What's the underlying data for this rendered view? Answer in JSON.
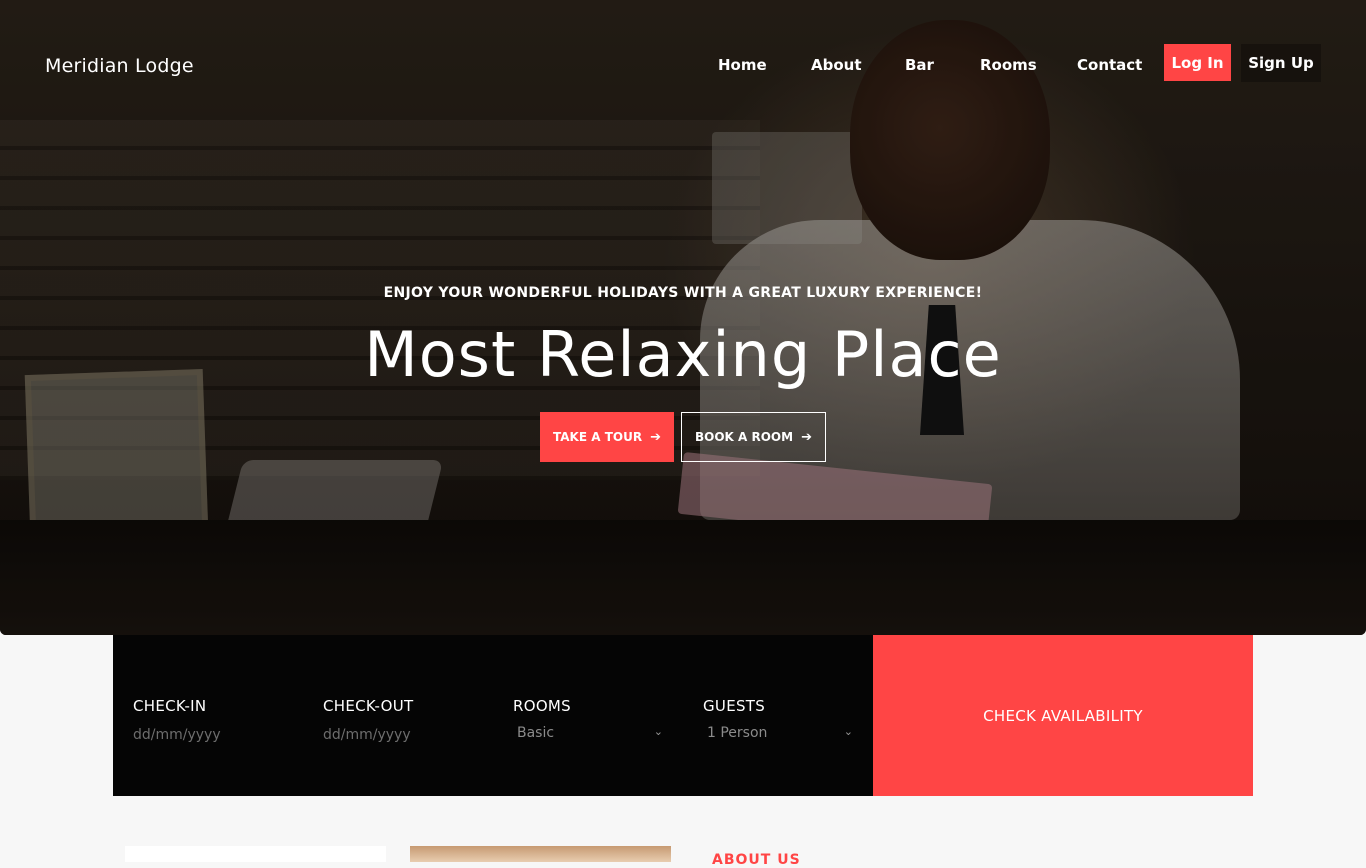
{
  "brand": {
    "logo_text": "Meridian Lodge",
    "accent_color": "#ff4545"
  },
  "nav": {
    "items": [
      {
        "label": "Home"
      },
      {
        "label": "About"
      },
      {
        "label": "Bar"
      },
      {
        "label": "Rooms"
      },
      {
        "label": "Contact"
      }
    ],
    "login_label": "Log In",
    "signup_label": "Sign Up"
  },
  "hero": {
    "tagline": "ENJOY YOUR WONDERFUL HOLIDAYS WITH A GREAT LUXURY EXPERIENCE!",
    "title": "Most Relaxing Place",
    "primary_button": {
      "label": "TAKE A TOUR",
      "icon": "arrow-right-icon"
    },
    "secondary_button": {
      "label": "BOOK A ROOM",
      "icon": "arrow-right-icon"
    }
  },
  "booking": {
    "checkin": {
      "label": "CHECK-IN",
      "placeholder": "dd/mm/yyyy"
    },
    "checkout": {
      "label": "CHECK-OUT",
      "placeholder": "dd/mm/yyyy"
    },
    "rooms": {
      "label": "ROOMS",
      "selected": "Basic"
    },
    "guests": {
      "label": "GUESTS",
      "selected": "1 Person"
    },
    "submit_label": "CHECK AVAILABILITY"
  },
  "about": {
    "heading": "ABOUT US"
  }
}
